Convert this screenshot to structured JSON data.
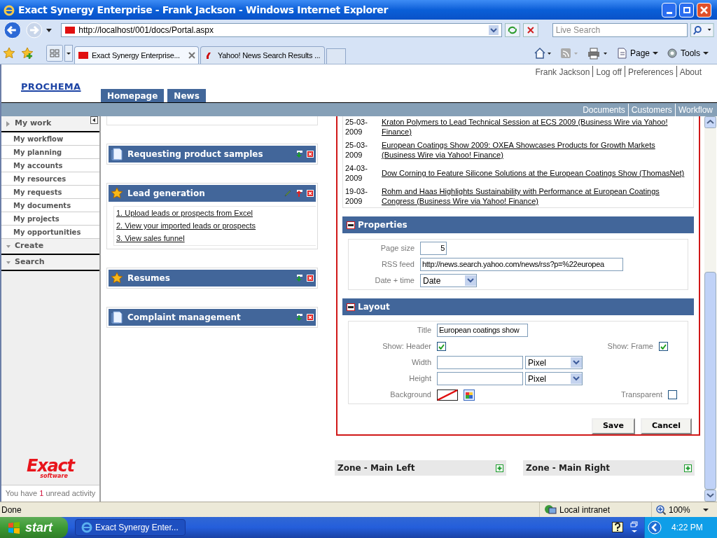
{
  "window": {
    "title": "Exact Synergy Enterprise - Frank Jackson - Windows Internet Explorer"
  },
  "browser": {
    "address": "http://localhost/001/docs/Portal.aspx",
    "search_placeholder": "Live Search",
    "tabs": [
      {
        "label": "Exact Synergy Enterprise...",
        "selected": true
      },
      {
        "label": "Yahoo! News Search Results ...",
        "selected": false
      }
    ],
    "toolbar": [
      "Page",
      "Tools"
    ]
  },
  "header": {
    "logo": "PROCHEMA",
    "user_links": [
      "Frank Jackson",
      "Log off",
      "Preferences",
      "About"
    ],
    "tabs": [
      "Homepage",
      "News"
    ],
    "nav_links": [
      "Documents",
      "Customers",
      "Workflow"
    ]
  },
  "sidebar": {
    "sections": [
      {
        "label": "My work",
        "items": [
          "My workflow",
          "My planning",
          "My accounts",
          "My resources",
          "My requests",
          "My documents",
          "My projects",
          "My opportunities"
        ]
      },
      {
        "label": "Create"
      },
      {
        "label": "Search"
      }
    ],
    "logo": "Exact",
    "logo_sub": "software",
    "activity": {
      "prefix": "You have",
      "count": "1",
      "suffix": "unread activity"
    }
  },
  "widgets": [
    {
      "title": "Requesting product samples",
      "kind": "page",
      "expanded": false
    },
    {
      "title": "Lead generation",
      "kind": "star",
      "expanded": true,
      "links": [
        "1. Upload leads or prospects from Excel",
        "2. View your imported leads or prospects",
        "3. View sales funnel"
      ]
    },
    {
      "title": "Resumes",
      "kind": "star",
      "expanded": false
    },
    {
      "title": "Complaint management",
      "kind": "page",
      "expanded": false
    }
  ],
  "news": [
    {
      "date": "25-03-2009",
      "title": "Kraton Polymers to Lead Technical Session at ECS 2009 (Business Wire via Yahoo! Finance)"
    },
    {
      "date": "25-03-2009",
      "title": "European Coatings Show 2009: OXEA Showcases Products for Growth Markets (Business Wire via Yahoo! Finance)"
    },
    {
      "date": "24-03-2009",
      "title": "Dow Corning to Feature Silicone Solutions at the European Coatings Show (ThomasNet)"
    },
    {
      "date": "19-03-2009",
      "title": "Rohm and Haas Highlights Sustainability with Performance at European Coatings Congress (Business Wire via Yahoo! Finance)"
    }
  ],
  "properties": {
    "heading": "Properties",
    "page_size_label": "Page size",
    "page_size": "5",
    "rss_label": "RSS feed",
    "rss_feed": "http://news.search.yahoo.com/news/rss?p=%22europea",
    "date_label": "Date + time",
    "date_time": "Date"
  },
  "layout": {
    "heading": "Layout",
    "title_label": "Title",
    "title": "European coatings show",
    "header_label": "Show: Header",
    "show_header": true,
    "frame_label": "Show: Frame",
    "show_frame": true,
    "width_label": "Width",
    "width_unit": "Pixel",
    "height_label": "Height",
    "height_unit": "Pixel",
    "background_label": "Background",
    "transparent_label": "Transparent",
    "transparent": false
  },
  "buttons": [
    "Save",
    "Cancel"
  ],
  "zones": [
    "Zone - Main Left",
    "Zone - Main Right"
  ],
  "status_bar": {
    "text": "Done",
    "zone": "Local intranet",
    "zoom": "100%"
  },
  "taskbar": {
    "start": "start",
    "task": "Exact Synergy Enter...",
    "clock": "4:22 PM"
  }
}
